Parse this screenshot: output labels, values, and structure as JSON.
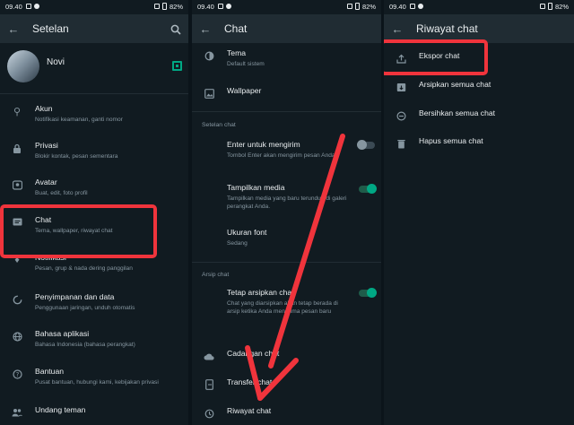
{
  "status": {
    "time": "09.40",
    "battery": "82%"
  },
  "settings": {
    "title": "Setelan",
    "profile_name": "Novi",
    "items": [
      {
        "title": "Akun",
        "subtitle": "Notifikasi keamanan, ganti nomor",
        "icon": "key-icon"
      },
      {
        "title": "Privasi",
        "subtitle": "Blokir kontak, pesan sementara",
        "icon": "lock-icon"
      },
      {
        "title": "Avatar",
        "subtitle": "Buat, edit, foto profil",
        "icon": "avatar-icon"
      },
      {
        "title": "Chat",
        "subtitle": "Tema, wallpaper, riwayat chat",
        "icon": "chat-icon"
      },
      {
        "title": "Notifikasi",
        "subtitle": "Pesan, grup & nada dering panggilan",
        "icon": "bell-icon"
      },
      {
        "title": "Penyimpanan dan data",
        "subtitle": "Penggunaan jaringan, unduh otomatis",
        "icon": "storage-icon"
      },
      {
        "title": "Bahasa aplikasi",
        "subtitle": "Bahasa Indonesia (bahasa perangkat)",
        "icon": "globe-icon"
      },
      {
        "title": "Bantuan",
        "subtitle": "Pusat bantuan, hubungi kami, kebijakan privasi",
        "icon": "help-icon"
      },
      {
        "title": "Undang teman",
        "subtitle": "",
        "icon": "people-icon"
      }
    ]
  },
  "chat": {
    "title": "Chat",
    "theme_title": "Tema",
    "theme_sub": "Default sistem",
    "wallpaper": "Wallpaper",
    "section_settings": "Setelan chat",
    "enter_title": "Enter untuk mengirim",
    "enter_sub": "Tombol Enter akan mengirim pesan Anda",
    "media_title": "Tampilkan media",
    "media_sub": "Tampilkan media yang baru terunduh di galeri perangkat Anda.",
    "font_title": "Ukuran font",
    "font_sub": "Sedang",
    "section_archive": "Arsip chat",
    "archive_title": "Tetap arsipkan chat",
    "archive_sub": "Chat yang diarsipkan akan tetap berada di arsip ketika Anda menerima pesan baru",
    "backup": "Cadangan chat",
    "transfer": "Transfer chat",
    "history": "Riwayat chat"
  },
  "history": {
    "title": "Riwayat chat",
    "items": [
      {
        "label": "Ekspor chat",
        "icon": "export-icon"
      },
      {
        "label": "Arsipkan semua chat",
        "icon": "archive-icon"
      },
      {
        "label": "Bersihkan semua chat",
        "icon": "clear-icon"
      },
      {
        "label": "Hapus semua chat",
        "icon": "trash-icon"
      }
    ]
  },
  "colors": {
    "annotation": "#f0343c",
    "accent": "#00a884",
    "background": "#111b21"
  }
}
